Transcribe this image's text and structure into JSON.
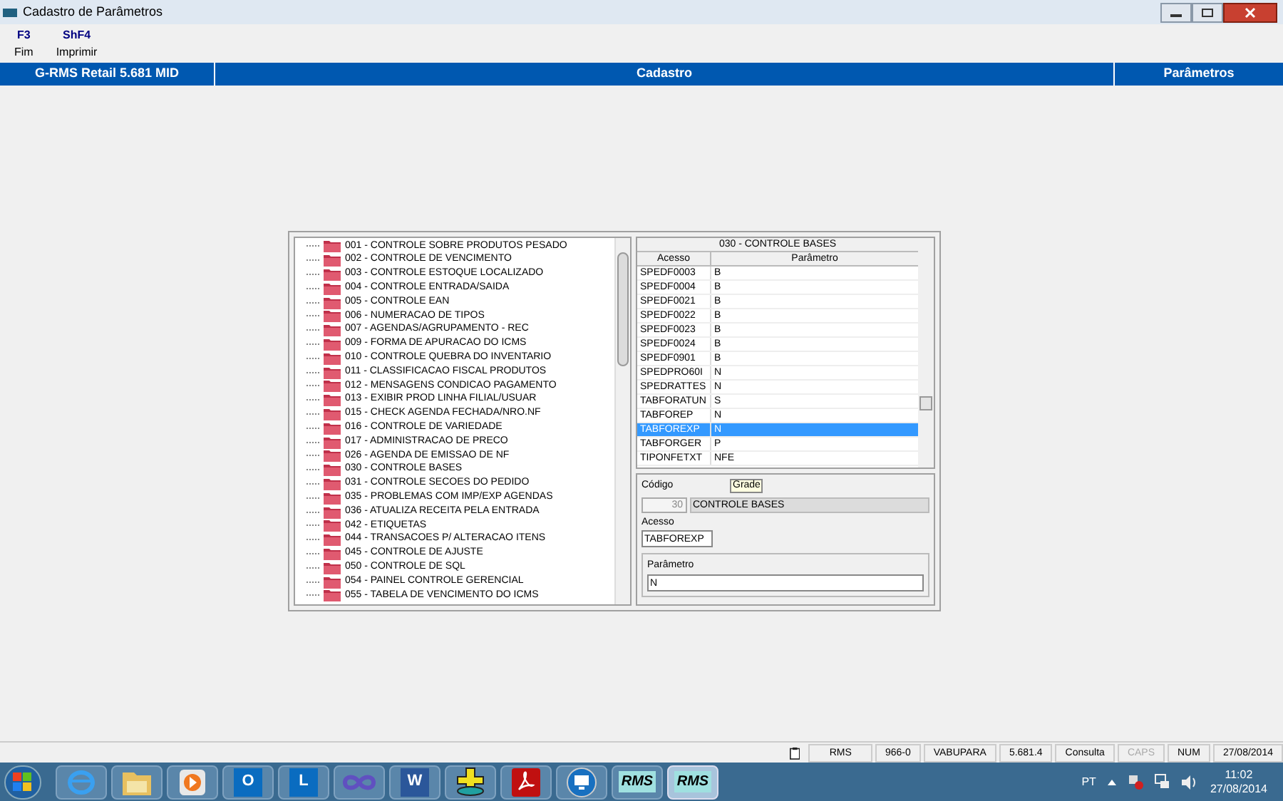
{
  "window": {
    "title": "Cadastro de Parâmetros"
  },
  "toolbar": [
    {
      "key": "F3",
      "label": "Fim"
    },
    {
      "key": "ShF4",
      "label": "Imprimir"
    }
  ],
  "header": {
    "app": "G-RMS Retail 5.681 MID",
    "module": "Cadastro",
    "screen": "Parâmetros"
  },
  "tree": {
    "items": [
      "001 - CONTROLE SOBRE PRODUTOS PESADO",
      "002 - CONTROLE DE VENCIMENTO",
      "003 - CONTROLE ESTOQUE LOCALIZADO",
      "004 - CONTROLE ENTRADA/SAIDA",
      "005 - CONTROLE EAN",
      "006 - NUMERACAO DE TIPOS",
      "007 - AGENDAS/AGRUPAMENTO - REC",
      "009 - FORMA DE APURACAO DO ICMS",
      "010 - CONTROLE QUEBRA DO INVENTARIO",
      "011 - CLASSIFICACAO FISCAL PRODUTOS",
      "012 - MENSAGENS CONDICAO PAGAMENTO",
      "013 - EXIBIR PROD LINHA FILIAL/USUAR",
      "015 - CHECK AGENDA FECHADA/NRO.NF",
      "016 - CONTROLE DE VARIEDADE",
      "017 - ADMINISTRACAO DE PRECO",
      "026 - AGENDA DE EMISSAO DE NF",
      "030 - CONTROLE BASES",
      "031 - CONTROLE SECOES DO PEDIDO",
      "035 - PROBLEMAS COM IMP/EXP AGENDAS",
      "036 - ATUALIZA RECEITA PELA ENTRADA",
      "042 - ETIQUETAS",
      "044 - TRANSACOES P/ ALTERACAO ITENS",
      "045 - CONTROLE DE AJUSTE",
      "050 - CONTROLE DE SQL",
      "054 - PAINEL CONTROLE GERENCIAL",
      "055 - TABELA DE VENCIMENTO DO ICMS"
    ]
  },
  "grid": {
    "title": "030 - CONTROLE BASES",
    "columns": [
      "Acesso",
      "Parâmetro"
    ],
    "rows": [
      {
        "acesso": "SPEDF0003",
        "parametro": "B",
        "selected": false
      },
      {
        "acesso": "SPEDF0004",
        "parametro": "B",
        "selected": false
      },
      {
        "acesso": "SPEDF0021",
        "parametro": "B",
        "selected": false
      },
      {
        "acesso": "SPEDF0022",
        "parametro": "B",
        "selected": false
      },
      {
        "acesso": "SPEDF0023",
        "parametro": "B",
        "selected": false
      },
      {
        "acesso": "SPEDF0024",
        "parametro": "B",
        "selected": false
      },
      {
        "acesso": "SPEDF0901",
        "parametro": "B",
        "selected": false
      },
      {
        "acesso": "SPEDPRO60I",
        "parametro": "N",
        "selected": false
      },
      {
        "acesso": "SPEDRATTES",
        "parametro": "N",
        "selected": false
      },
      {
        "acesso": "TABFORATUN",
        "parametro": "S",
        "selected": false
      },
      {
        "acesso": "TABFOREP",
        "parametro": "N",
        "selected": false
      },
      {
        "acesso": "TABFOREXP",
        "parametro": "N",
        "selected": true
      },
      {
        "acesso": "TABFORGER",
        "parametro": "P",
        "selected": false
      },
      {
        "acesso": "TIPONFETXT",
        "parametro": "NFE",
        "selected": false
      }
    ]
  },
  "form": {
    "codigo_label": "Código",
    "codigo": "30",
    "descricao": "CONTROLE BASES",
    "tooltip": "Grade",
    "acesso_label": "Acesso",
    "acesso": "TABFOREXP",
    "parametro_label": "Parâmetro",
    "parametro": "N"
  },
  "status_bar": [
    {
      "text": "RMS",
      "on": true
    },
    {
      "text": "966-0",
      "on": true
    },
    {
      "text": "VABUPARA",
      "on": true
    },
    {
      "text": "5.681.4",
      "on": true
    },
    {
      "text": "Consulta",
      "on": true
    },
    {
      "text": "CAPS",
      "on": false
    },
    {
      "text": "NUM",
      "on": true
    },
    {
      "text": "27/08/2014",
      "on": true
    }
  ],
  "taskbar": {
    "apps": [
      {
        "kind": "ie"
      },
      {
        "kind": "folder"
      },
      {
        "kind": "media"
      },
      {
        "kind": "outlook",
        "label": "O"
      },
      {
        "kind": "lync",
        "label": "L"
      },
      {
        "kind": "infinity"
      },
      {
        "kind": "word",
        "label": "W"
      },
      {
        "kind": "stack"
      },
      {
        "kind": "pdf"
      },
      {
        "kind": "remote"
      },
      {
        "kind": "rms",
        "label": "RMS",
        "selected": false
      },
      {
        "kind": "rms",
        "label": "RMS",
        "selected": true
      }
    ],
    "language": "PT",
    "time": "11:02",
    "date": "27/08/2014"
  }
}
